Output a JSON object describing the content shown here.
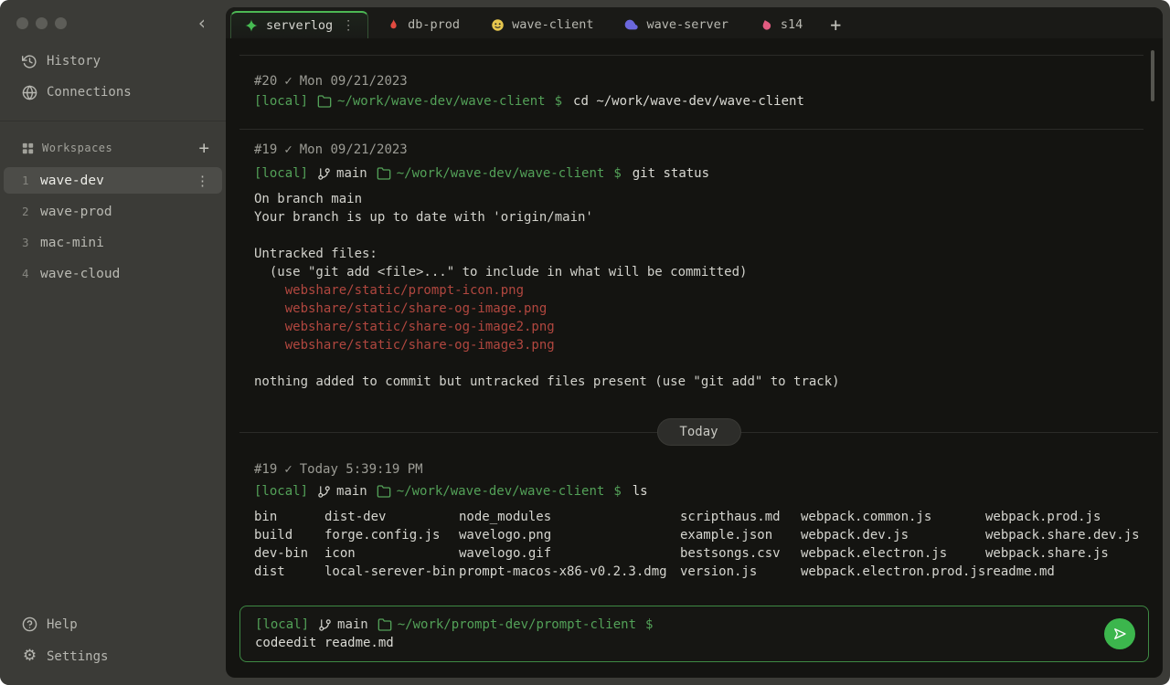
{
  "icons": {
    "chevron_left": "‹",
    "kebab": "⋮",
    "plus": "+",
    "check": "✓",
    "gear": "⚙"
  },
  "sidebar": {
    "history": "History",
    "connections": "Connections",
    "workspaces_label": "Workspaces",
    "workspaces": [
      {
        "num": "1",
        "label": "wave-dev"
      },
      {
        "num": "2",
        "label": "wave-prod"
      },
      {
        "num": "3",
        "label": "mac-mini"
      },
      {
        "num": "4",
        "label": "wave-cloud"
      }
    ],
    "help": "Help",
    "settings": "Settings"
  },
  "tabs": {
    "items": [
      {
        "label": "serverlog",
        "icon": "sparkle-icon",
        "color": "#46bb52"
      },
      {
        "label": "db-prod",
        "icon": "flame-icon",
        "color": "#e24a3f"
      },
      {
        "label": "wave-client",
        "icon": "face-icon",
        "color": "#e6c64d"
      },
      {
        "label": "wave-server",
        "icon": "cloud-icon",
        "color": "#6b67dd"
      },
      {
        "label": "s14",
        "icon": "blob-icon",
        "color": "#e25b80"
      }
    ]
  },
  "terminal": {
    "today_label": "Today",
    "entries": [
      {
        "num": "#20",
        "date": "Mon 09/21/2023",
        "host": "[local]",
        "cwd": "~/work/wave-dev/wave-client",
        "dollar": "$",
        "command": "cd ~/work/wave-dev/wave-client"
      },
      {
        "num": "#19",
        "date": "Mon 09/21/2023",
        "host": "[local]",
        "branch": "main",
        "cwd": "~/work/wave-dev/wave-client",
        "dollar": "$",
        "command": "git status",
        "output": [
          "On branch main",
          "Your branch is up to date with 'origin/main'",
          "Untracked files:",
          "  (use \"git add <file>...\" to include in what will be committed)",
          "    webshare/static/prompt-icon.png",
          "    webshare/static/share-og-image.png",
          "    webshare/static/share-og-image2.png",
          "    webshare/static/share-og-image3.png",
          "nothing added to commit but untracked files present (use \"git add\" to track)"
        ]
      },
      {
        "num": "#19",
        "date": "Today 5:39:19 PM",
        "host": "[local]",
        "branch": "main",
        "cwd": "~/work/wave-dev/wave-client",
        "dollar": "$",
        "command": "ls",
        "ls_columns": [
          [
            "bin",
            "build",
            "dev-bin",
            "dist"
          ],
          [
            "dist-dev",
            "forge.config.js",
            "icon",
            "local-serever-bin"
          ],
          [
            "node_modules",
            "wavelogo.png",
            "wavelogo.gif",
            "prompt-macos-x86-v0.2.3.dmg"
          ],
          [
            "scripthaus.md",
            "example.json",
            "bestsongs.csv",
            "version.js"
          ],
          [
            "webpack.common.js",
            "webpack.dev.js",
            "webpack.electron.js",
            "webpack.electron.prod.js"
          ],
          [
            "webpack.prod.js",
            "webpack.share.dev.js",
            "webpack.share.js",
            "readme.md"
          ]
        ]
      }
    ]
  },
  "input": {
    "host": "[local]",
    "branch": "main",
    "cwd": "~/work/prompt-dev/prompt-client",
    "dollar": "$",
    "command": "codeedit readme.md"
  }
}
